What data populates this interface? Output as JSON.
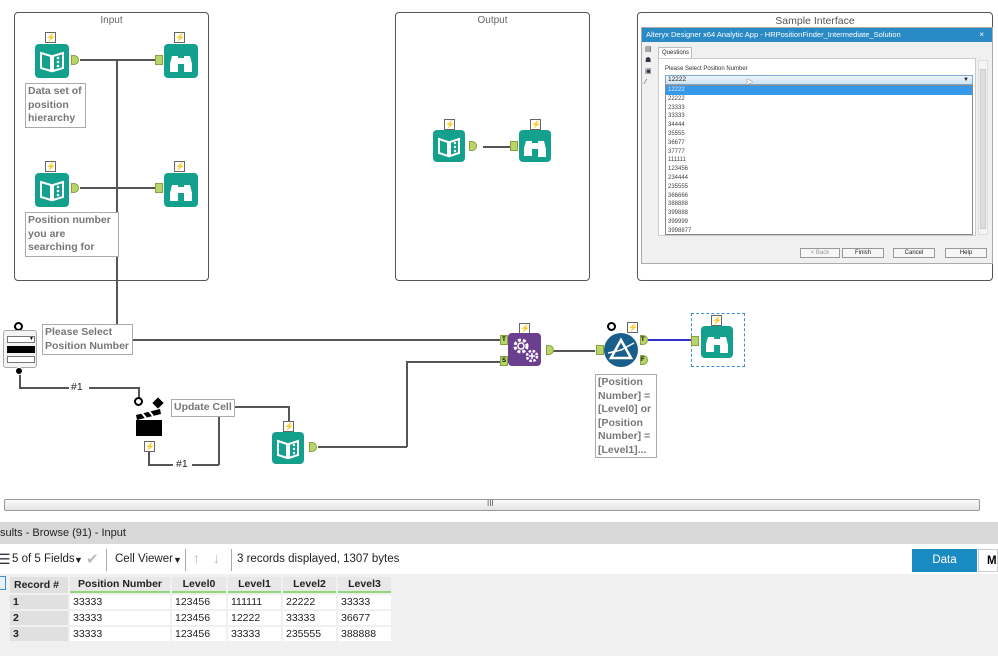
{
  "canvas": {
    "containers": {
      "input": {
        "title": "Input"
      },
      "output": {
        "title": "Output"
      },
      "sample": {
        "title": "Sample Interface"
      }
    },
    "annotations": {
      "dataset": "Data set of position hierarchy",
      "position_search": "Position number you are searching for",
      "dropdown_label": "Please Select Position Number",
      "update_cell": "Update Cell",
      "filter_expr": "[Position Number] = [Level0] or [Position Number] = [Level1]..."
    },
    "wire_labels": {
      "first": "#1",
      "second": "#1"
    },
    "anchor_labels": {
      "append_target": "T",
      "append_source": "S",
      "filter_true": "T",
      "filter_false": "F"
    },
    "bolt": "⚡",
    "icons": {
      "input_data": "book-icon",
      "browse": "binoculars-icon",
      "append_fields": "gears-icon",
      "filter": "prism-icon",
      "dropdown": "dropdown-icon",
      "action": "clapperboard-icon"
    }
  },
  "sample_interface": {
    "window_title": "Alteryx Designer x64 Analytic App - HRPositionFinder_Intermediate_Solution",
    "close": "×",
    "tab": "Questions",
    "question_label": "Please Select Position Number",
    "selected_value": "12222",
    "options": [
      "12222",
      "22222",
      "23333",
      "33333",
      "34444",
      "35555",
      "36677",
      "37777",
      "111111",
      "123456",
      "234444",
      "235555",
      "366666",
      "388888",
      "399888",
      "399999",
      "3998877"
    ],
    "buttons": {
      "back": "< Back",
      "finish": "Finish",
      "cancel": "Cancel",
      "help": "Help"
    }
  },
  "results": {
    "header": "sults - Browse (91) - Input",
    "fields_selector": "5 of 5 Fields",
    "cell_viewer": "Cell Viewer",
    "status": "3 records displayed, 1307 bytes",
    "tabs": {
      "data": "Data",
      "metadata": "M"
    },
    "columns": [
      "Record #",
      "Position Number",
      "Level0",
      "Level1",
      "Level2",
      "Level3"
    ],
    "rows": [
      [
        "1",
        "33333",
        "123456",
        "111111",
        "22222",
        "33333"
      ],
      [
        "2",
        "33333",
        "123456",
        "12222",
        "33333",
        "36677"
      ],
      [
        "3",
        "33333",
        "123456",
        "33333",
        "235555",
        "388888"
      ]
    ]
  },
  "scrollbar": {
    "grip": "III"
  }
}
